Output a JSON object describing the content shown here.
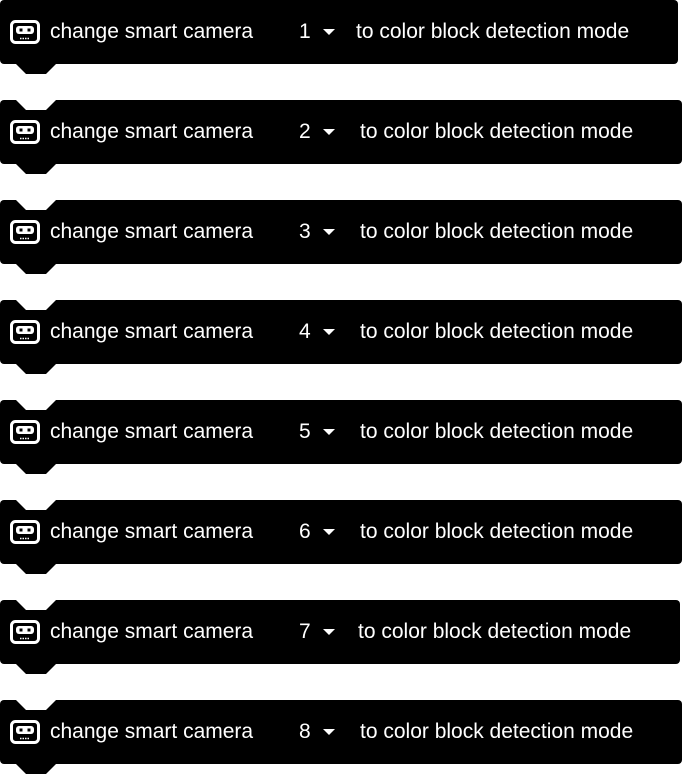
{
  "blocks": [
    {
      "label": "change smart camera",
      "camera": "1",
      "suffix": "to color block detection mode"
    },
    {
      "label": "change smart camera",
      "camera": "2",
      "suffix": "to color block detection mode"
    },
    {
      "label": "change smart camera",
      "camera": "3",
      "suffix": "to color block detection mode"
    },
    {
      "label": "change smart camera",
      "camera": "4",
      "suffix": "to color block detection mode"
    },
    {
      "label": "change smart camera",
      "camera": "5",
      "suffix": "to color block detection mode"
    },
    {
      "label": "change smart camera",
      "camera": "6",
      "suffix": "to color block detection mode"
    },
    {
      "label": "change smart camera",
      "camera": "7",
      "suffix": "to color block detection mode"
    },
    {
      "label": "change smart camera",
      "camera": "8",
      "suffix": "to color block detection mode"
    }
  ],
  "icon": "smart-camera-icon",
  "colors": {
    "block_background": "#000000",
    "text": "#ffffff",
    "page_background": "#ffffff"
  }
}
